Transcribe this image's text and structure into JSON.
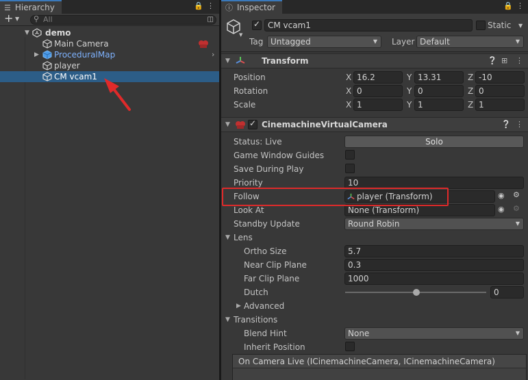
{
  "hierarchy": {
    "tab_label": "Hierarchy",
    "add_label": "+",
    "search_placeholder": "All",
    "scene": "demo",
    "items": [
      {
        "label": "Main Camera"
      },
      {
        "label": "ProceduralMap"
      },
      {
        "label": "player"
      },
      {
        "label": "CM vcam1"
      }
    ]
  },
  "inspector": {
    "tab_label": "Inspector",
    "object_name": "CM vcam1",
    "static_label": "Static",
    "tag_label": "Tag",
    "tag_value": "Untagged",
    "layer_label": "Layer",
    "layer_value": "Default",
    "transform": {
      "title": "Transform",
      "rows": [
        {
          "label": "Position",
          "x": "16.2",
          "y": "13.31",
          "z": "-10"
        },
        {
          "label": "Rotation",
          "x": "0",
          "y": "0",
          "z": "0"
        },
        {
          "label": "Scale",
          "x": "1",
          "y": "1",
          "z": "1"
        }
      ]
    },
    "vcam": {
      "title": "CinemachineVirtualCamera",
      "status_label": "Status: Live",
      "solo_label": "Solo",
      "game_window_guides": "Game Window Guides",
      "save_during_play": "Save During Play",
      "priority_label": "Priority",
      "priority_value": "10",
      "follow_label": "Follow",
      "follow_value": "player (Transform)",
      "lookat_label": "Look At",
      "lookat_value": "None (Transform)",
      "standby_label": "Standby Update",
      "standby_value": "Round Robin",
      "lens_label": "Lens",
      "ortho_label": "Ortho Size",
      "ortho_value": "5.7",
      "near_label": "Near Clip Plane",
      "near_value": "0.3",
      "far_label": "Far Clip Plane",
      "far_value": "1000",
      "dutch_label": "Dutch",
      "dutch_value": "0",
      "advanced_label": "Advanced",
      "transitions_label": "Transitions",
      "blend_label": "Blend Hint",
      "blend_value": "None",
      "inherit_label": "Inherit Position",
      "event_label": "On Camera Live (ICinemachineCamera, ICinemachineCamera)"
    },
    "axis": {
      "x": "X",
      "y": "Y",
      "z": "Z"
    }
  },
  "colors": {
    "selection": "#2c5d87",
    "prefab_text": "#7fb3ff",
    "annotation": "#e02a2a"
  }
}
